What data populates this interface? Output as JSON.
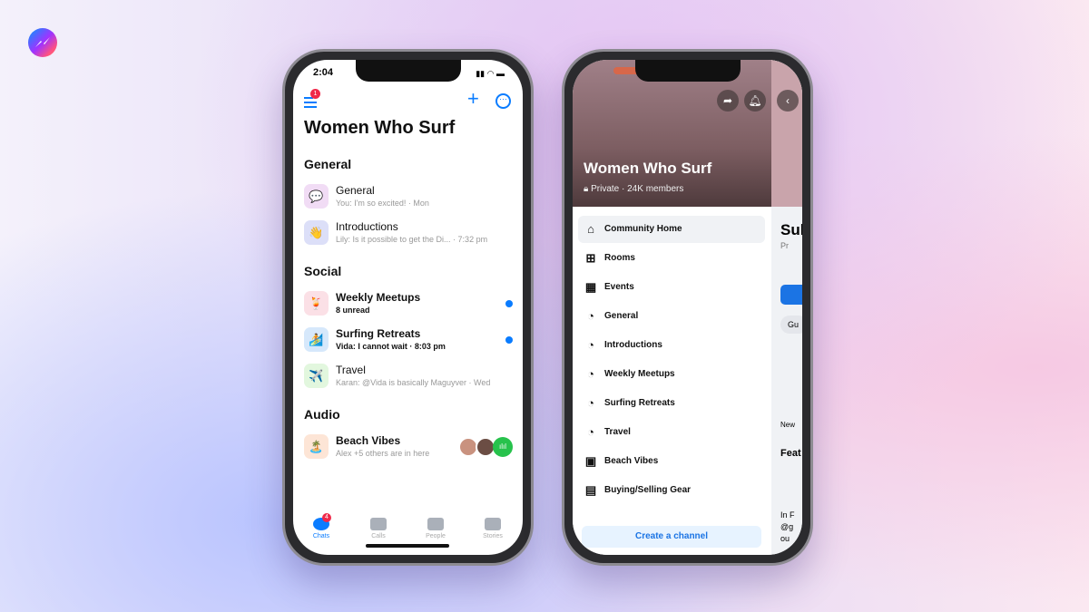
{
  "left_phone": {
    "time": "2:04",
    "menu_badge": "1",
    "title": "Women Who Surf",
    "sections": [
      {
        "title": "General",
        "items": [
          {
            "name": "General",
            "sub": "You: I'm so excited! · Mon",
            "icon": "💬",
            "unread": false
          },
          {
            "name": "Introductions",
            "sub": "Lily: Is it possible to get the Di... · 7:32 pm",
            "icon": "👋",
            "unread": false
          }
        ]
      },
      {
        "title": "Social",
        "items": [
          {
            "name": "Weekly Meetups",
            "sub": "8 unread",
            "icon": "🍹",
            "unread": true
          },
          {
            "name": "Surfing Retreats",
            "sub": "Vida: I cannot wait · 8:03 pm",
            "icon": "🏄",
            "unread": true
          },
          {
            "name": "Travel",
            "sub": "Karan: @Vida is basically Maguyver · Wed",
            "icon": "✈️",
            "unread": false
          }
        ]
      },
      {
        "title": "Audio",
        "items": [
          {
            "name": "Beach Vibes",
            "sub": "Alex +5 others are in here",
            "icon": "🏝️",
            "unread": false
          }
        ]
      }
    ],
    "tabs": [
      {
        "label": "Chats",
        "badge": "4",
        "active": true
      },
      {
        "label": "Calls"
      },
      {
        "label": "People"
      },
      {
        "label": "Stories"
      }
    ],
    "accent": "#0a7cff"
  },
  "right_phone": {
    "title": "Women Who Surf",
    "subtitle": "Private · 24K members",
    "menu": [
      "Community Home",
      "Rooms",
      "Events",
      "General",
      "Introductions",
      "Weekly Meetups",
      "Surfing Retreats",
      "Travel",
      "Beach Vibes",
      "Buying/Selling Gear"
    ],
    "create_label": "Create a channel",
    "behind": {
      "title": "Sul",
      "privacy": "Pr",
      "chip": "Gu",
      "banner": "New",
      "featured": "Feat",
      "post1": "In F",
      "post2": "@g",
      "post3": "ou"
    }
  }
}
